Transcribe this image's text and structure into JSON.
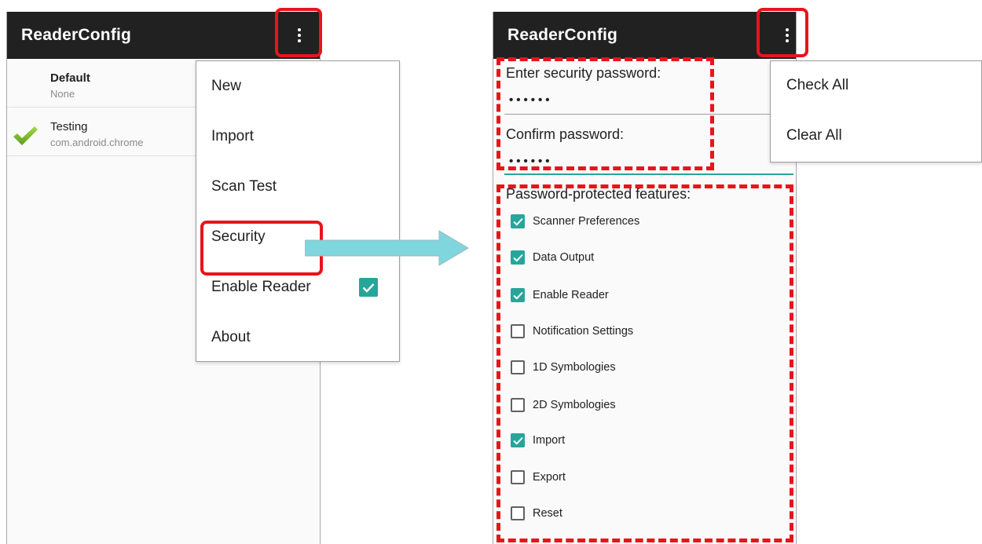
{
  "colors": {
    "appbar": "#212121",
    "accent_teal": "#26a69a",
    "callout_red": "#e8141c",
    "arrow_fill": "#7fd6dc"
  },
  "left_screen": {
    "app_title": "ReaderConfig",
    "overflow_icon": "overflow-menu-icon",
    "profiles": [
      {
        "name": "Default",
        "subtitle": "None",
        "active": false
      },
      {
        "name": "Testing",
        "subtitle": "com.android.chrome",
        "active": true
      }
    ],
    "menu": {
      "items": [
        {
          "label": "New"
        },
        {
          "label": "Import"
        },
        {
          "label": "Scan Test"
        },
        {
          "label": "Security"
        },
        {
          "label": "Enable Reader",
          "checked": true
        },
        {
          "label": "About"
        }
      ]
    }
  },
  "right_screen": {
    "app_title": "ReaderConfig",
    "password_label": "Enter security password:",
    "password_value": "••••••",
    "confirm_label": "Confirm password:",
    "confirm_value": "••••••",
    "features_label": "Password-protected features:",
    "features": [
      {
        "label": "Scanner Preferences",
        "checked": true
      },
      {
        "label": "Data Output",
        "checked": true
      },
      {
        "label": "Enable Reader",
        "checked": true
      },
      {
        "label": "Notification Settings",
        "checked": false
      },
      {
        "label": "1D Symbologies",
        "checked": false
      },
      {
        "label": "2D Symbologies",
        "checked": false
      },
      {
        "label": "Import",
        "checked": true
      },
      {
        "label": "Export",
        "checked": false
      },
      {
        "label": "Reset",
        "checked": false
      }
    ],
    "menu": {
      "items": [
        {
          "label": "Check All"
        },
        {
          "label": "Clear All"
        }
      ]
    }
  }
}
